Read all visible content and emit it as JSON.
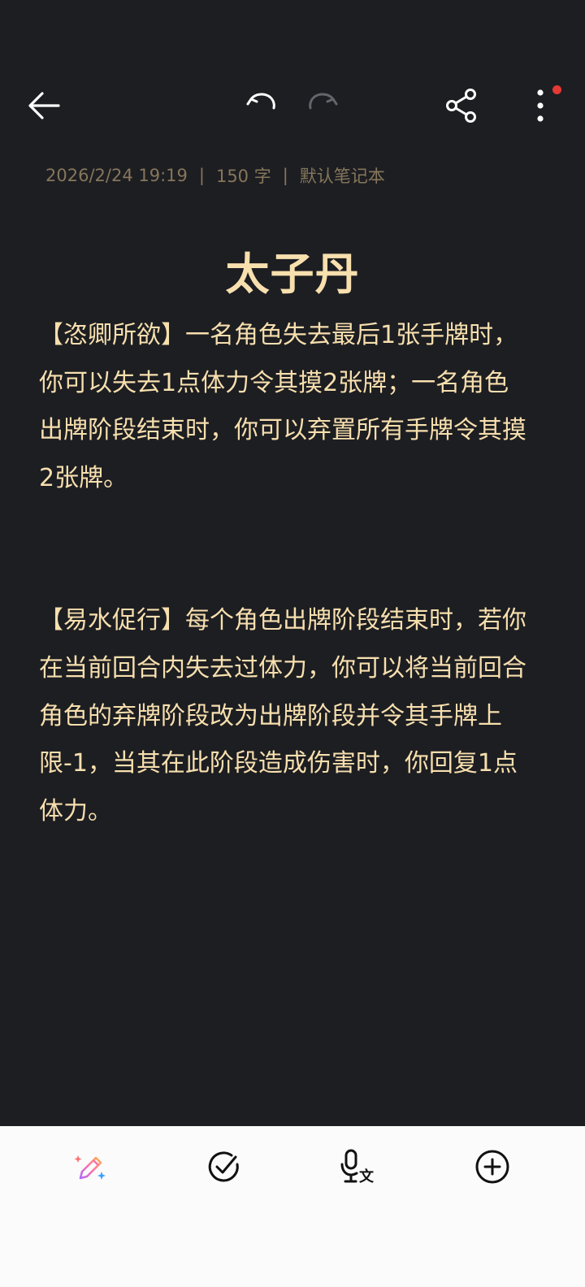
{
  "toolbar": {
    "icons": [
      "back-arrow-icon",
      "undo-icon",
      "redo-icon",
      "share-icon",
      "more-vertical-icon"
    ],
    "notification_color": "#e53935"
  },
  "meta": {
    "datetime": "2026/2/24 19:19",
    "separator": "|",
    "word_count": "150 字",
    "notebook": "默认笔记本"
  },
  "note": {
    "title": "太子丹",
    "paragraphs": [
      "【恣卿所欲】一名角色失去最后1张手牌时，你可以失去1点体力令其摸2张牌；一名角色出牌阶段结束时，你可以弃置所有手牌令其摸2张牌。",
      "【易水促行】每个角色出牌阶段结束时，若你在当前回合内失去过体力，你可以将当前回合角色的弃牌阶段改为出牌阶段并令其手牌上限-1，当其在此阶段造成伤害时，你回复1点体力。"
    ]
  },
  "bottom_bar": {
    "icons": [
      "ai-pen-icon",
      "checklist-icon",
      "voice-to-text-icon",
      "add-circle-icon"
    ]
  },
  "colors": {
    "background": "#1d1e22",
    "text": "#f7dfae",
    "meta_text": "#86765b",
    "bottom_bar": "#fbfbfb"
  }
}
